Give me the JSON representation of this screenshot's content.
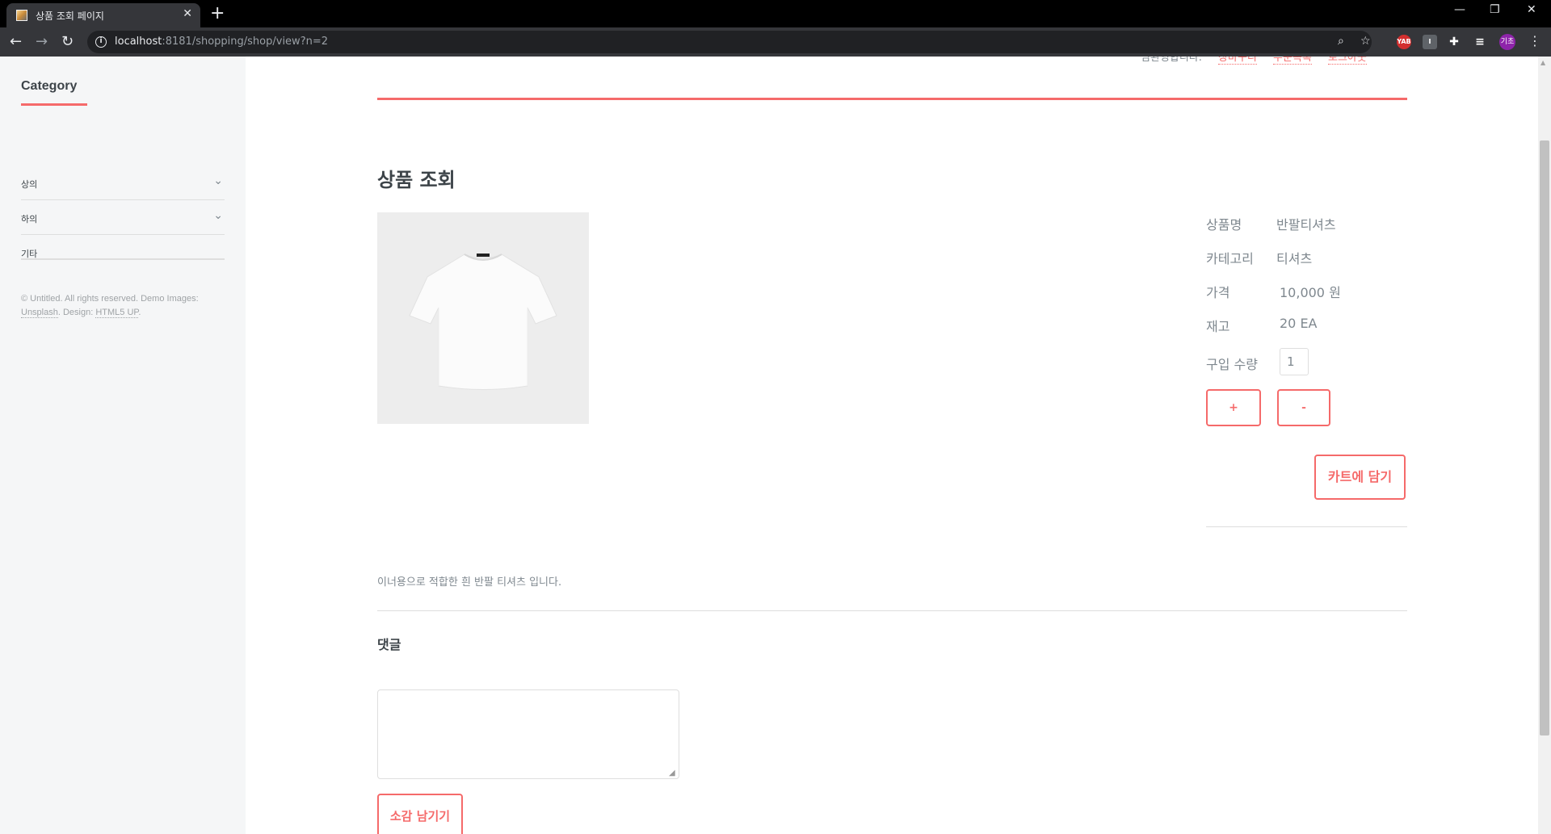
{
  "browser": {
    "tab_title": "상품 조회 페이지",
    "url_host": "localhost",
    "url_rest": ":8181/shopping/shop/view?n=2",
    "avatar_text": "기초",
    "ext_label": "YAB"
  },
  "header": {
    "notice_text": "님환영합니다.",
    "links": [
      "장바구니",
      "주문목록",
      "로그아웃"
    ]
  },
  "sidebar": {
    "title": "Category",
    "items": [
      {
        "label": "상의",
        "expandable": true
      },
      {
        "label": "하의",
        "expandable": true
      },
      {
        "label": "기타",
        "expandable": false
      }
    ],
    "footer": {
      "text1": "© Untitled. All rights reserved. Demo Images: ",
      "link1": "Unsplash",
      "text2": ". Design: ",
      "link2": "HTML5 UP",
      "text3": "."
    }
  },
  "main": {
    "page_title": "상품 조회",
    "product": {
      "name_label": "상품명",
      "name_value": "반팔티셔츠",
      "category_label": "카테고리",
      "category_value": "티셔츠",
      "price_label": "가격",
      "price_value": "10,000 원",
      "stock_label": "재고",
      "stock_value": "20 EA",
      "qty_label": "구입 수량",
      "qty_value": "1"
    },
    "buttons": {
      "plus": "+",
      "minus": "-",
      "add_to_cart": "카트에 담기",
      "submit_comment": "소감 남기기"
    },
    "description": "이너용으로 적합한 흰 반팔 티셔츠 입니다.",
    "comment_title": "댓글"
  },
  "colors": {
    "accent": "#f56a6a",
    "text": "#7f888f",
    "heading": "#3d4449",
    "sidebar_bg": "#f5f6f7"
  }
}
